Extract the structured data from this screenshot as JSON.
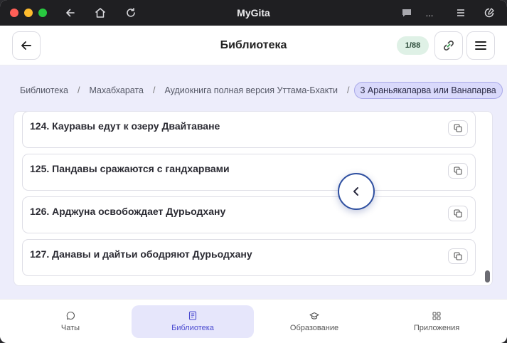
{
  "window": {
    "title": "MyGita",
    "titlebar_icons": [
      "arrow-left-icon",
      "home-icon",
      "reload-icon",
      "chat-bubble-icon",
      "more-icon",
      "menu-icon",
      "settings-icon"
    ],
    "more_label": "..."
  },
  "header": {
    "title": "Библиотека",
    "counter": "1/88",
    "back_icon": "arrow-left-icon",
    "link_icon": "link-icon",
    "menu_icon": "hamburger-icon"
  },
  "breadcrumb": {
    "items": [
      "Библиотека",
      "Махабхарата",
      "Аудиокнига полная версия Уттама-Бхакти"
    ],
    "separator": "/",
    "active": "3 Араньякапарва или Ванапарва"
  },
  "list": {
    "items": [
      {
        "title": "124. Кауравы едут к озеру Двайтаване"
      },
      {
        "title": "125. Пандавы сражаются с гандхарвами"
      },
      {
        "title": "126. Арджуна освобождает Дурьодхану"
      },
      {
        "title": "127. Данавы и дайтьи ободряют Дурьодхану"
      }
    ],
    "copy_icon": "copy-icon",
    "scroll_position": 0.97
  },
  "float_button": {
    "icon": "chevron-left-icon"
  },
  "bottom_nav": {
    "items": [
      {
        "label": "Чаты",
        "icon": "chat-icon",
        "active": false
      },
      {
        "label": "Библиотека",
        "icon": "book-icon",
        "active": true
      },
      {
        "label": "Образование",
        "icon": "graduation-cap-icon",
        "active": false
      },
      {
        "label": "Приложения",
        "icon": "grid-icon",
        "active": false
      }
    ]
  },
  "colors": {
    "accent": "#4a4ad0",
    "content_bg": "#ededfb",
    "counter_bg": "#dff1e6",
    "float_border": "#2e4fa0"
  }
}
